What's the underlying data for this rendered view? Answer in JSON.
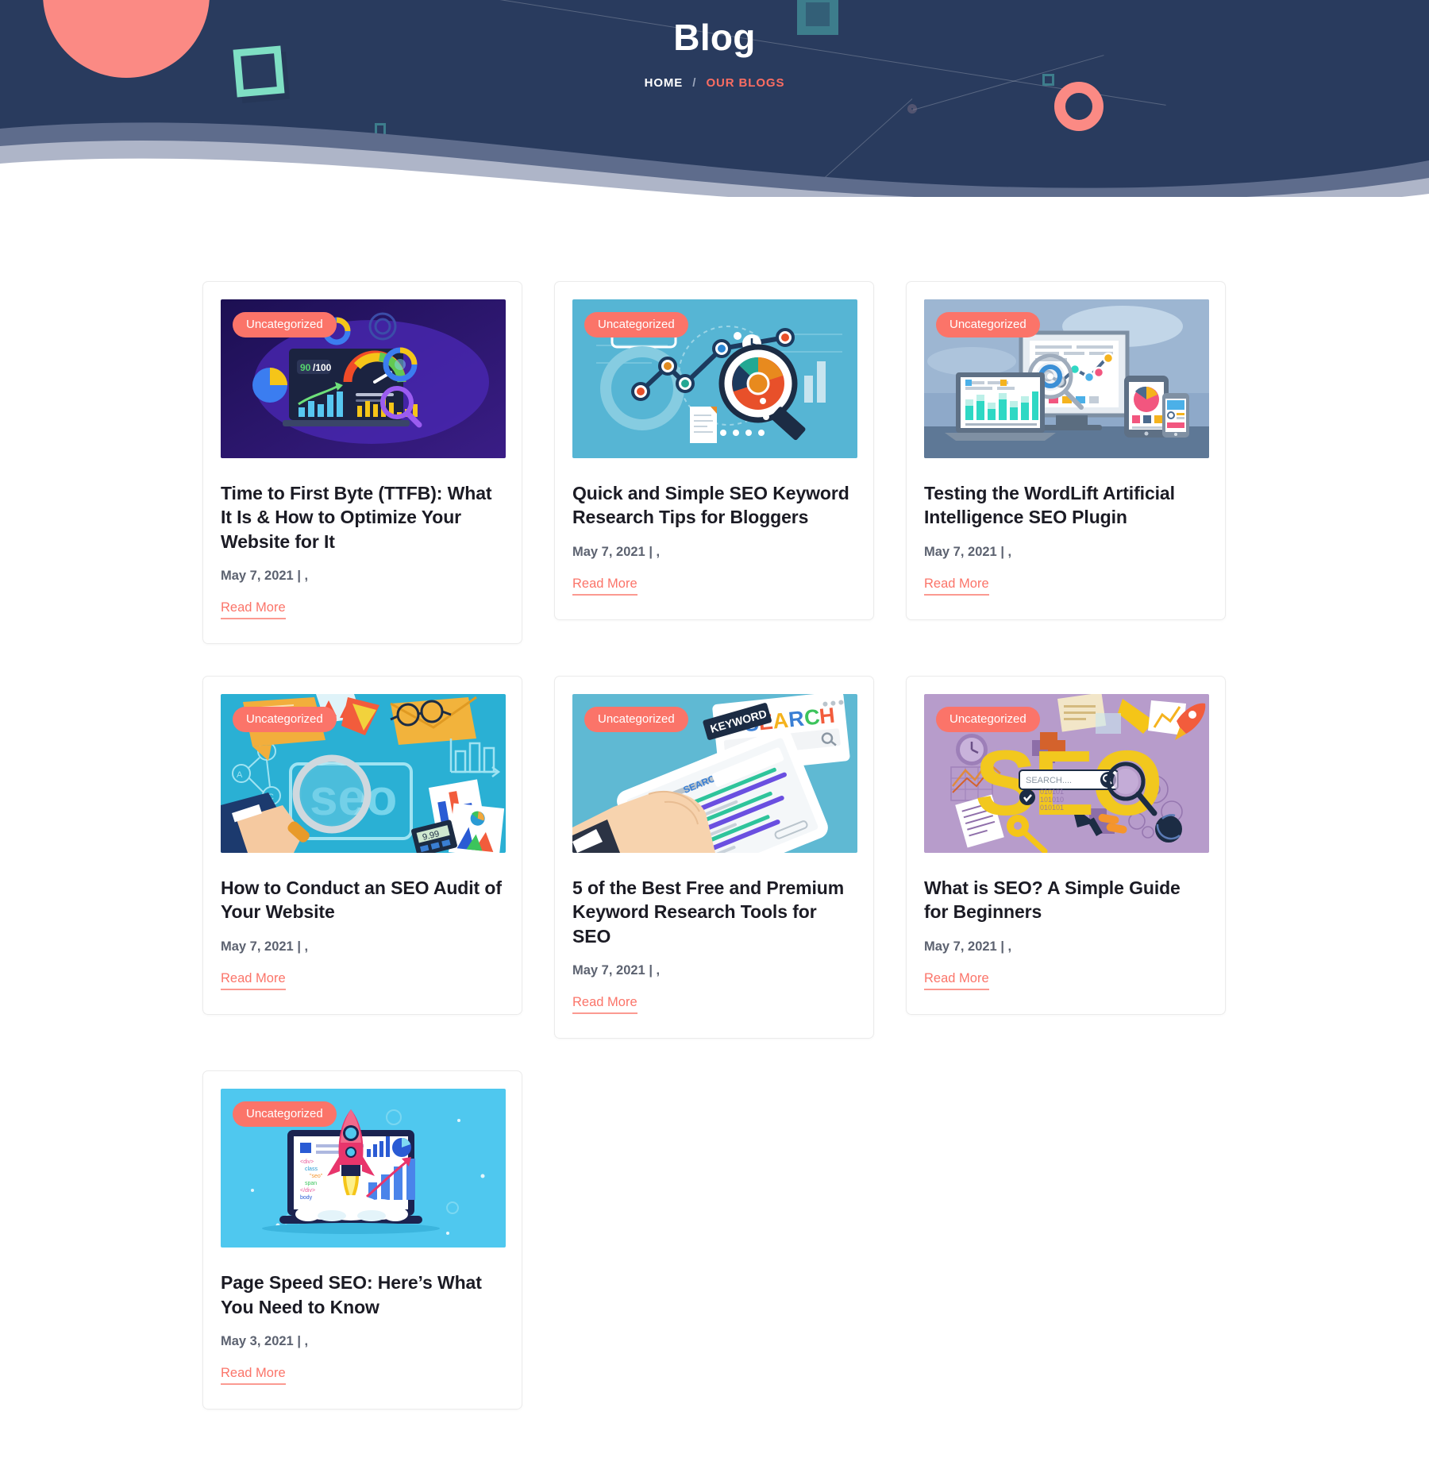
{
  "header": {
    "title": "Blog",
    "breadcrumb": {
      "home": "HOME",
      "separator": "/",
      "current": "OUR BLOGS"
    },
    "colors": {
      "background": "#293b5e",
      "accent_coral": "#fb7469",
      "mint": "#7fdfc4",
      "teal": "#3d7d8c",
      "wave_mid": "#5e6c8c",
      "wave_light": "#aeb5c8"
    }
  },
  "posts": [
    {
      "badge": "Uncategorized",
      "title": "Time to First Byte (TTFB): What It Is & How to Optimize Your Website for It",
      "date": "May 7, 2021 | ,",
      "read_more": "Read More",
      "thumb": "ttfb-dashboard-gauge",
      "thumb_bg": "#2a1a6e",
      "thumb_label": "90/100"
    },
    {
      "badge": "Uncategorized",
      "title": "Quick and Simple SEO Keyword Research Tips for Bloggers",
      "date": "May 7, 2021 | ,",
      "read_more": "Read More",
      "thumb": "keyword-research-magnifier-chart",
      "thumb_bg": "#56b5d4",
      "thumb_label": ""
    },
    {
      "badge": "Uncategorized",
      "title": "Testing the WordLift Artificial Intelligence SEO Plugin",
      "date": "May 7, 2021 | ,",
      "read_more": "Read More",
      "thumb": "multi-device-analytics",
      "thumb_bg": "#a6bdd6",
      "thumb_label": ""
    },
    {
      "badge": "Uncategorized",
      "title": "How to Conduct an SEO Audit of Your Website",
      "date": "May 7, 2021 | ,",
      "read_more": "Read More",
      "thumb": "seo-audit-desk-magnifier",
      "thumb_bg": "#2ab0d4",
      "thumb_label": "SEO"
    },
    {
      "badge": "Uncategorized",
      "title": "5 of the Best Free and Premium Keyword Research Tools for SEO",
      "date": "May 7, 2021 | ,",
      "read_more": "Read More",
      "thumb": "tablet-search-keyword",
      "thumb_bg": "#5fb9d3",
      "thumb_label": "SEARCH KEYWORD"
    },
    {
      "badge": "Uncategorized",
      "title": "What is SEO? A Simple Guide for Beginners",
      "date": "May 7, 2021 | ,",
      "read_more": "Read More",
      "thumb": "seo-big-letters-purple",
      "thumb_bg": "#b79ccb",
      "thumb_label": "SEO"
    },
    {
      "badge": "Uncategorized",
      "title": "Page Speed SEO: Here’s What You Need to Know",
      "date": "May 3, 2021 | ,",
      "read_more": "Read More",
      "thumb": "rocket-launch-laptop",
      "thumb_bg": "#4fc8ef",
      "thumb_label": ""
    }
  ]
}
